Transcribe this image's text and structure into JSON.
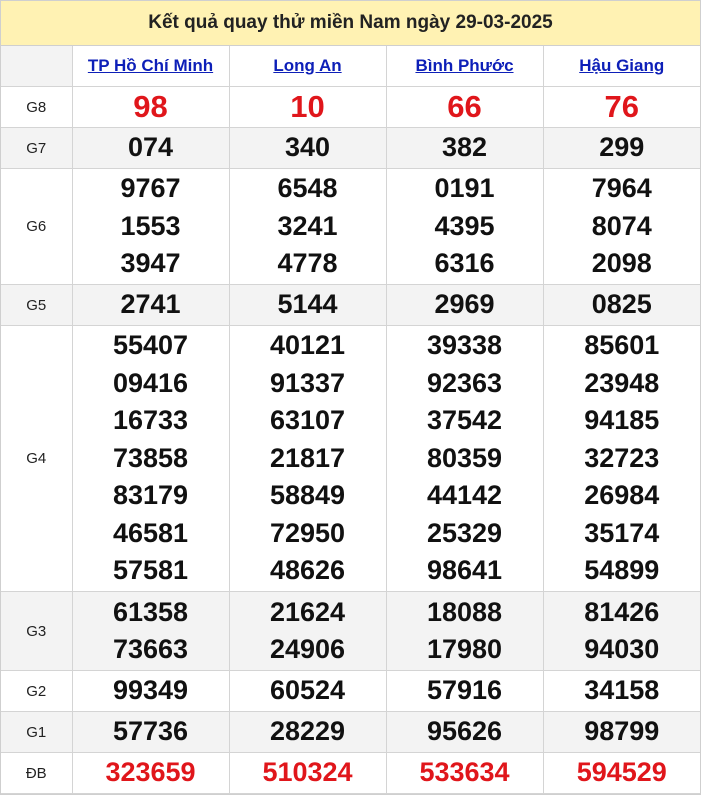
{
  "title": "Kết quả quay thử miền Nam ngày 29-03-2025",
  "provinces": [
    "TP Hồ Chí Minh",
    "Long An",
    "Bình Phước",
    "Hậu Giang"
  ],
  "rows": [
    {
      "label": "G8",
      "red": true,
      "cells": [
        [
          "98"
        ],
        [
          "10"
        ],
        [
          "66"
        ],
        [
          "76"
        ]
      ]
    },
    {
      "label": "G7",
      "red": false,
      "cells": [
        [
          "074"
        ],
        [
          "340"
        ],
        [
          "382"
        ],
        [
          "299"
        ]
      ]
    },
    {
      "label": "G6",
      "red": false,
      "cells": [
        [
          "9767",
          "1553",
          "3947"
        ],
        [
          "6548",
          "3241",
          "4778"
        ],
        [
          "0191",
          "4395",
          "6316"
        ],
        [
          "7964",
          "8074",
          "2098"
        ]
      ]
    },
    {
      "label": "G5",
      "red": false,
      "cells": [
        [
          "2741"
        ],
        [
          "5144"
        ],
        [
          "2969"
        ],
        [
          "0825"
        ]
      ]
    },
    {
      "label": "G4",
      "red": false,
      "cells": [
        [
          "55407",
          "09416",
          "16733",
          "73858",
          "83179",
          "46581",
          "57581"
        ],
        [
          "40121",
          "91337",
          "63107",
          "21817",
          "58849",
          "72950",
          "48626"
        ],
        [
          "39338",
          "92363",
          "37542",
          "80359",
          "44142",
          "25329",
          "98641"
        ],
        [
          "85601",
          "23948",
          "94185",
          "32723",
          "26984",
          "35174",
          "54899"
        ]
      ]
    },
    {
      "label": "G3",
      "red": false,
      "cells": [
        [
          "61358",
          "73663"
        ],
        [
          "21624",
          "24906"
        ],
        [
          "18088",
          "17980"
        ],
        [
          "81426",
          "94030"
        ]
      ]
    },
    {
      "label": "G2",
      "red": false,
      "cells": [
        [
          "99349"
        ],
        [
          "60524"
        ],
        [
          "57916"
        ],
        [
          "34158"
        ]
      ]
    },
    {
      "label": "G1",
      "red": false,
      "cells": [
        [
          "57736"
        ],
        [
          "28229"
        ],
        [
          "95626"
        ],
        [
          "98799"
        ]
      ]
    },
    {
      "label": "ĐB",
      "red": true,
      "cells": [
        [
          "323659"
        ],
        [
          "510324"
        ],
        [
          "533634"
        ],
        [
          "594529"
        ]
      ]
    }
  ],
  "colors": {
    "header_bg": "#fff2b3",
    "link": "#0d1fb8",
    "red": "#e0161b",
    "shade": "#f3f3f3"
  }
}
